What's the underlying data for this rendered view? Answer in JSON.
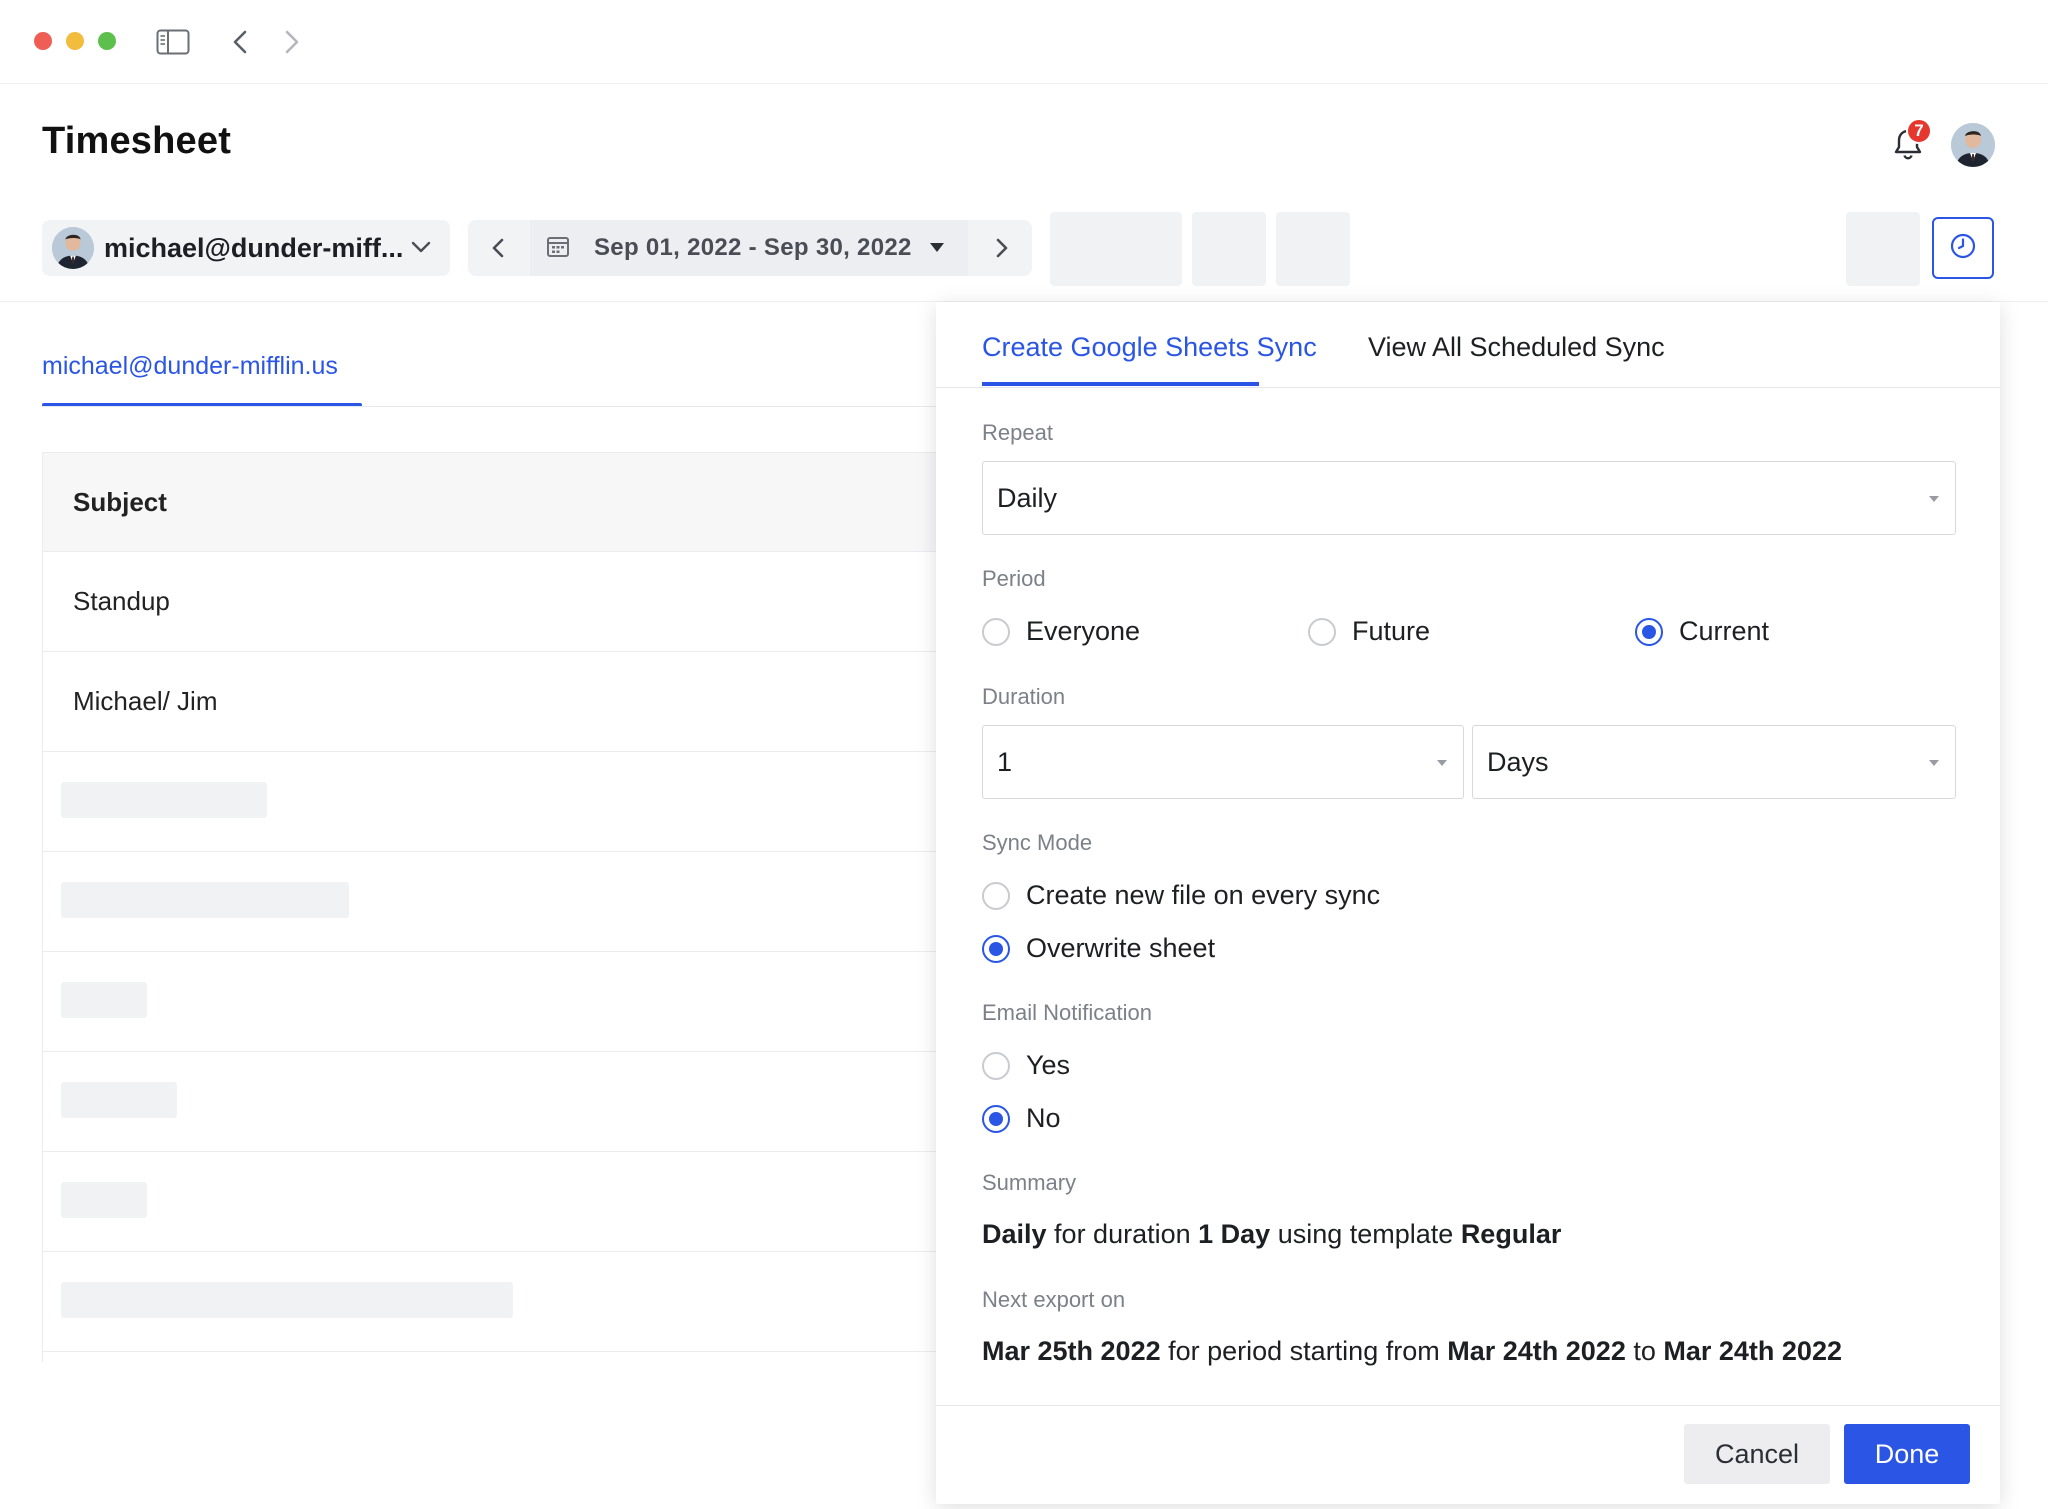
{
  "header": {
    "title": "Timesheet",
    "notification_count": "7"
  },
  "toolbar": {
    "user_select_label": "michael@dunder-miff...",
    "date_range_label": "Sep 01, 2022 - Sep 30, 2022"
  },
  "left": {
    "tab_label": "michael@dunder-mifflin.us",
    "table": {
      "header": "Subject",
      "rows": [
        "Standup",
        "Michael/ Jim"
      ]
    }
  },
  "panel": {
    "tabs": [
      "Create Google Sheets Sync",
      "View All Scheduled Sync"
    ],
    "repeat": {
      "label": "Repeat",
      "value": "Daily"
    },
    "period": {
      "label": "Period",
      "options": [
        "Everyone",
        "Future",
        "Current"
      ],
      "selected": "Current"
    },
    "duration": {
      "label": "Duration",
      "amount": "1",
      "unit": "Days"
    },
    "sync_mode": {
      "label": "Sync Mode",
      "options": [
        "Create new file on every sync",
        "Overwrite sheet"
      ],
      "selected": "Overwrite sheet"
    },
    "email_notification": {
      "label": "Email Notification",
      "options": [
        "Yes",
        "No"
      ],
      "selected": "No"
    },
    "summary": {
      "label": "Summary",
      "repeat": "Daily",
      "text_1": " for duration ",
      "duration": "1 Day",
      "text_2": " using template ",
      "template": "Regular"
    },
    "next_export": {
      "label": "Next export on",
      "date": "Mar 25th 2022",
      "text_1": " for period starting from ",
      "start": "Mar 24th 2022",
      "text_2": " to ",
      "end": "Mar 24th 2022"
    },
    "buttons": {
      "cancel": "Cancel",
      "done": "Done"
    }
  },
  "colors": {
    "accent": "#2a55e5",
    "badge": "#e5372e"
  }
}
